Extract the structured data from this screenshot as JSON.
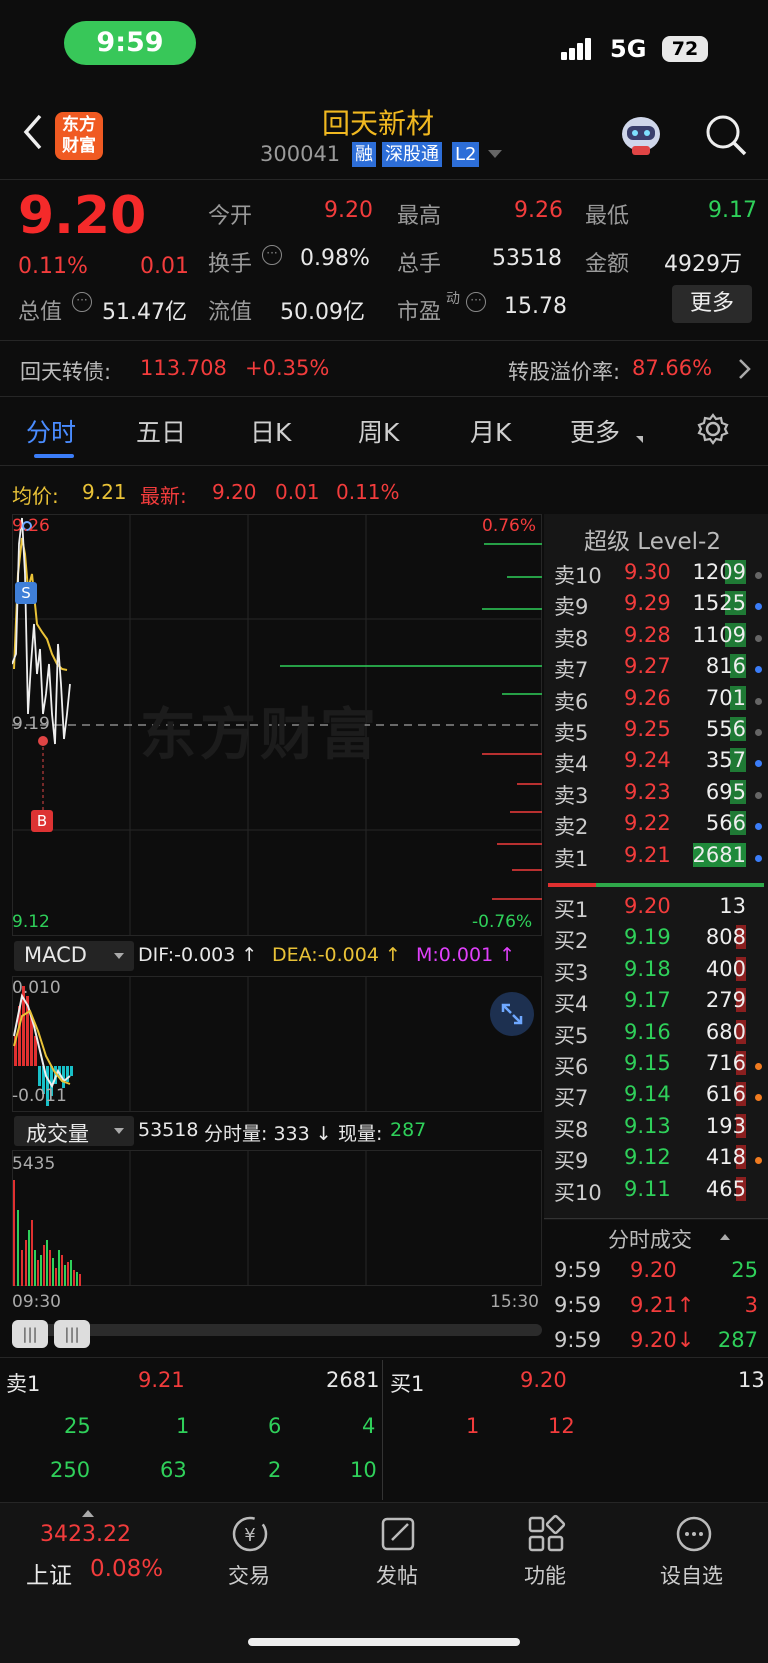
{
  "status": {
    "time": "9:59",
    "network": "5G",
    "battery": "72"
  },
  "header": {
    "logo_top": "东方",
    "logo_bottom": "财富",
    "title": "回天新材",
    "code": "300041",
    "tags": [
      "融",
      "深股通",
      "L2"
    ]
  },
  "quote": {
    "price": "9.20",
    "change_pct": "0.11%",
    "change": "0.01",
    "labels": {
      "open": "今开",
      "high": "最高",
      "low": "最低",
      "turnover": "换手",
      "volume": "总手",
      "amount": "金额",
      "total_value": "总值",
      "float_value": "流值",
      "pe": "市盈",
      "pe_sup": "动",
      "more": "更多"
    },
    "open": "9.20",
    "high": "9.26",
    "low": "9.17",
    "turnover": "0.98%",
    "volume": "53518",
    "amount": "4929万",
    "total_value": "51.47亿",
    "float_value": "50.09亿",
    "pe": "15.78"
  },
  "bond": {
    "name": "回天转债:",
    "price": "113.708",
    "change": "+0.35%",
    "premium_label": "转股溢价率:",
    "premium": "87.66%"
  },
  "tabs": [
    "分时",
    "五日",
    "日K",
    "周K",
    "月K",
    "更多"
  ],
  "chart": {
    "avg_label": "均价:",
    "avg": "9.21",
    "latest_label": "最新:",
    "latest": "9.20",
    "latest_chg": "0.01",
    "latest_pct": "0.11%",
    "y_top": "9.26",
    "y_mid": "9.19",
    "y_bottom": "9.12",
    "pct_top": "0.76%",
    "pct_bottom": "-0.76%",
    "watermark": "东方财富",
    "sell_mark": "S",
    "buy_mark": "B",
    "macd_label": "MACD",
    "dif": "DIF:-0.003 ↑",
    "dea": "DEA:-0.004 ↑",
    "m": "M:0.001 ↑",
    "macd_top": "0.010",
    "macd_bottom": "-0.011",
    "vol_label": "成交量",
    "vol_total": "53518",
    "vol_period": "分时量: 333 ↓",
    "vol_now_label": "现量:",
    "vol_now": "287",
    "vol_max": "5435",
    "time_start": "09:30",
    "time_end": "15:30"
  },
  "level2": {
    "title": "超级 Level-2",
    "asks": [
      {
        "label": "卖10",
        "price": "9.30",
        "vol": "1209"
      },
      {
        "label": "卖9",
        "price": "9.29",
        "vol": "1525"
      },
      {
        "label": "卖8",
        "price": "9.28",
        "vol": "1109"
      },
      {
        "label": "卖7",
        "price": "9.27",
        "vol": "816"
      },
      {
        "label": "卖6",
        "price": "9.26",
        "vol": "701"
      },
      {
        "label": "卖5",
        "price": "9.25",
        "vol": "556"
      },
      {
        "label": "卖4",
        "price": "9.24",
        "vol": "357"
      },
      {
        "label": "卖3",
        "price": "9.23",
        "vol": "695"
      },
      {
        "label": "卖2",
        "price": "9.22",
        "vol": "566"
      },
      {
        "label": "卖1",
        "price": "9.21",
        "vol": "2681"
      }
    ],
    "bids": [
      {
        "label": "买1",
        "price": "9.20",
        "vol": "13"
      },
      {
        "label": "买2",
        "price": "9.19",
        "vol": "808"
      },
      {
        "label": "买3",
        "price": "9.18",
        "vol": "400"
      },
      {
        "label": "买4",
        "price": "9.17",
        "vol": "279"
      },
      {
        "label": "买5",
        "price": "9.16",
        "vol": "680"
      },
      {
        "label": "买6",
        "price": "9.15",
        "vol": "716"
      },
      {
        "label": "买7",
        "price": "9.14",
        "vol": "616"
      },
      {
        "label": "买8",
        "price": "9.13",
        "vol": "193"
      },
      {
        "label": "买9",
        "price": "9.12",
        "vol": "418"
      },
      {
        "label": "买10",
        "price": "9.11",
        "vol": "465"
      }
    ],
    "trades_title": "分时成交",
    "trades": [
      {
        "time": "9:59",
        "price": "9.20",
        "vol": "25"
      },
      {
        "time": "9:59",
        "price": "9.21↑",
        "vol": "3"
      },
      {
        "time": "9:59",
        "price": "9.20↓",
        "vol": "287"
      }
    ]
  },
  "queue": {
    "sell_label": "卖1",
    "sell_price": "9.21",
    "sell_vol": "2681",
    "buy_label": "买1",
    "buy_price": "9.20",
    "buy_vol": "13",
    "sell_orders": [
      "25",
      "1",
      "6",
      "4",
      "250",
      "63",
      "2",
      "10"
    ],
    "buy_orders": [
      "1",
      "12"
    ]
  },
  "bottom": {
    "index_value": "3423.22",
    "index_name": "上证",
    "index_pct": "0.08%",
    "buttons": [
      "交易",
      "发帖",
      "功能",
      "设自选"
    ]
  }
}
